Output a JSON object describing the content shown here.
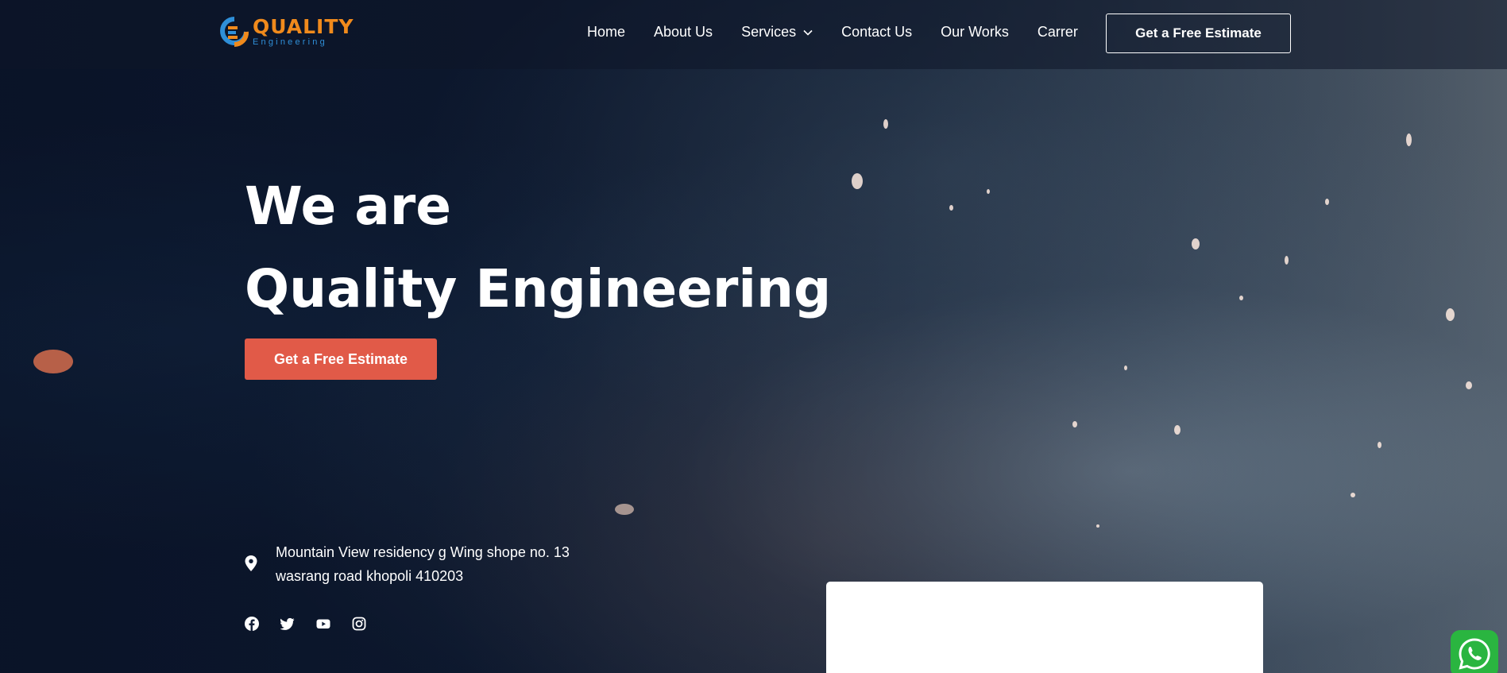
{
  "brand": {
    "name": "QUALITY",
    "tagline": "Engineering",
    "colors": {
      "orange": "#f08a1c",
      "blue": "#2f8fd8"
    }
  },
  "nav": {
    "items": [
      {
        "label": "Home"
      },
      {
        "label": "About Us"
      },
      {
        "label": "Services",
        "has_dropdown": true
      },
      {
        "label": "Contact Us"
      },
      {
        "label": "Our Works"
      },
      {
        "label": "Carrer"
      }
    ],
    "cta_label": "Get a Free Estimate"
  },
  "hero": {
    "line1": "We are",
    "line2": "Quality Engineering",
    "cta_label": "Get a Free Estimate",
    "cta_color": "#e15a48"
  },
  "contact": {
    "address_line1": "Mountain View residency g Wing shope no. 13",
    "address_line2": "wasrang road khopoli 410203",
    "icon": "map-pin-icon"
  },
  "social": [
    "facebook-icon",
    "twitter-icon",
    "youtube-icon",
    "instagram-icon"
  ],
  "whatsapp": {
    "icon": "whatsapp-icon",
    "color": "#2ab540"
  }
}
